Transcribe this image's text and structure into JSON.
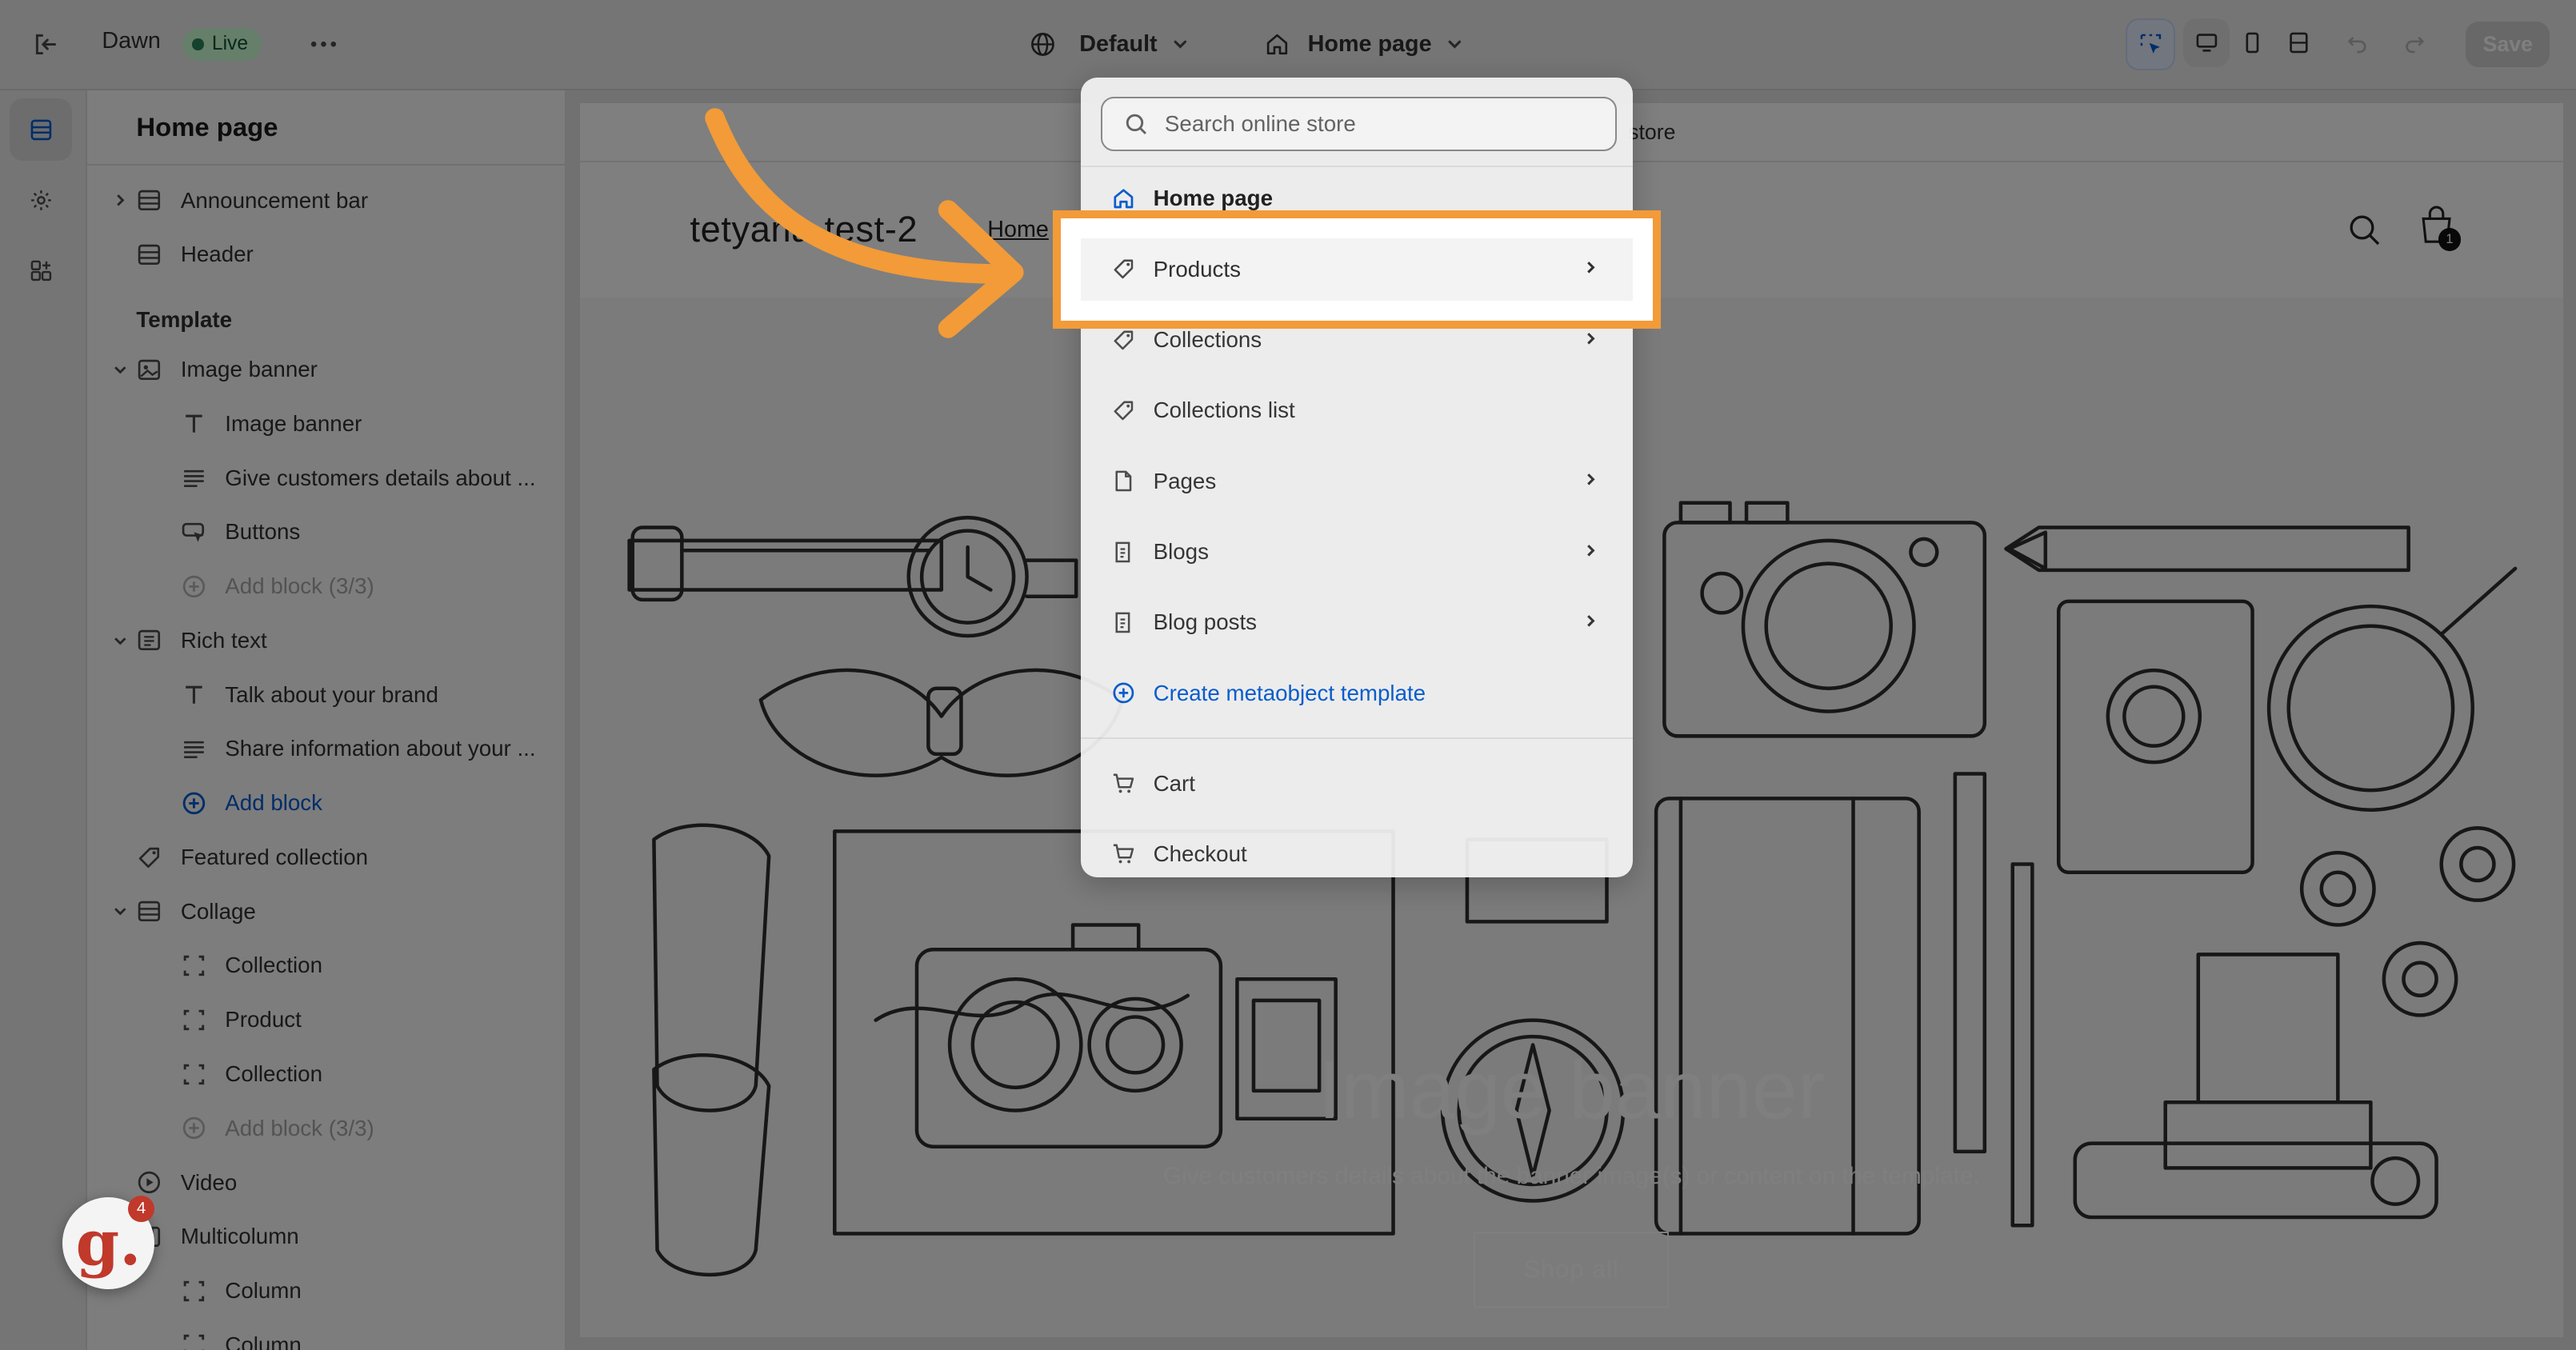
{
  "topbar": {
    "theme_name": "Dawn",
    "live_badge": "Live",
    "theme_selector": "Default",
    "page_selector": "Home page",
    "save_label": "Save"
  },
  "sidebar": {
    "title": "Home page",
    "header_items": [
      {
        "label": "Announcement bar"
      },
      {
        "label": "Header"
      }
    ],
    "template_label": "Template",
    "items": [
      {
        "label": "Image banner"
      },
      {
        "label": "Image banner"
      },
      {
        "label": "Give customers details about ..."
      },
      {
        "label": "Buttons"
      },
      {
        "label": "Add block (3/3)"
      },
      {
        "label": "Rich text"
      },
      {
        "label": "Talk about your brand"
      },
      {
        "label": "Share information about your ..."
      },
      {
        "label": "Add block"
      },
      {
        "label": "Featured collection"
      },
      {
        "label": "Collage"
      },
      {
        "label": "Collection"
      },
      {
        "label": "Product"
      },
      {
        "label": "Collection"
      },
      {
        "label": "Add block (3/3)"
      },
      {
        "label": "Video"
      },
      {
        "label": "Multicolumn"
      },
      {
        "label": "Column"
      },
      {
        "label": "Column"
      }
    ]
  },
  "preview": {
    "announcement_text": "store",
    "store_name": "tetyana-test-2",
    "nav_home": "Home",
    "banner_title": "Image banner",
    "banner_subtitle": "Give customers details about the banner image(s) or content on the template.",
    "shop_button": "Shop all",
    "cart_count": "1"
  },
  "dropdown": {
    "search_placeholder": "Search online store",
    "items": [
      {
        "label": "Home page",
        "icon": "home-icon"
      },
      {
        "label": "Products",
        "icon": "tag-icon"
      },
      {
        "label": "Collections",
        "icon": "tag-icon"
      },
      {
        "label": "Collections list",
        "icon": "tag-icon"
      },
      {
        "label": "Pages",
        "icon": "page-icon"
      },
      {
        "label": "Blogs",
        "icon": "blog-icon"
      },
      {
        "label": "Blog posts",
        "icon": "blog-icon"
      },
      {
        "label": "Create metaobject template",
        "icon": "plus-circle-icon"
      },
      {
        "label": "Cart",
        "icon": "cart-icon"
      },
      {
        "label": "Checkout",
        "icon": "cart-icon"
      }
    ]
  },
  "badge": {
    "letter": "g.",
    "count": "4"
  },
  "colors": {
    "highlight": "#f29b38",
    "link": "#005bd3",
    "live_bg": "#cdfed4"
  }
}
